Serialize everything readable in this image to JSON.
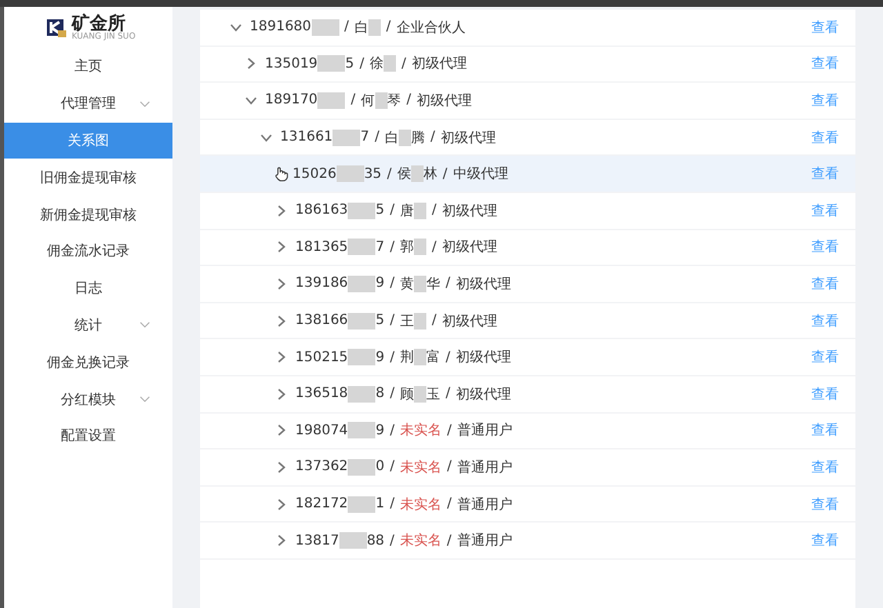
{
  "logo": {
    "name": "矿金所",
    "subtitle": "KUANG JIN SUO"
  },
  "sidebar": {
    "items": [
      {
        "label": "主页",
        "selected": false
      },
      {
        "label": "代理管理",
        "selected": false,
        "expandable": true
      },
      {
        "label": "关系图",
        "selected": true
      },
      {
        "label": "旧佣金提现审核",
        "selected": false
      },
      {
        "label": "新佣金提现审核",
        "selected": false
      },
      {
        "label": "佣金流水记录",
        "selected": false
      },
      {
        "label": "日志",
        "selected": false
      },
      {
        "label": "统计",
        "selected": false,
        "expandable": true
      },
      {
        "label": "佣金兑换记录",
        "selected": false
      },
      {
        "label": "分红模块",
        "selected": false,
        "expandable": true
      },
      {
        "label": "配置设置",
        "selected": false
      }
    ]
  },
  "separator": "/",
  "tree": [
    {
      "phone": {
        "start": "1891680"
      },
      "name": {
        "start": "白"
      },
      "masked": true,
      "unverified": false,
      "role": "企业合伙人",
      "action": "查看",
      "expanded": true,
      "selected": false,
      "children": [
        {
          "phone": {
            "start": "135019",
            "end": "5"
          },
          "name": {
            "start": "徐"
          },
          "masked": true,
          "unverified": false,
          "role": "初级代理",
          "action": "查看",
          "expanded": false,
          "selected": false
        },
        {
          "phone": {
            "start": "189170"
          },
          "name": {
            "start": "何",
            "end": "琴"
          },
          "masked": true,
          "unverified": false,
          "role": "初级代理",
          "action": "查看",
          "expanded": true,
          "selected": false,
          "children": [
            {
              "phone": {
                "start": "131661",
                "end": "7"
              },
              "name": {
                "start": "白",
                "end": "腾"
              },
              "masked": true,
              "unverified": false,
              "role": "初级代理",
              "action": "查看",
              "expanded": true,
              "selected": false,
              "children": [
                {
                  "phone": {
                    "start": "15026",
                    "end": "35"
                  },
                  "name": {
                    "start": "侯",
                    "end": "林"
                  },
                  "masked": true,
                  "unverified": false,
                  "role": "中级代理",
                  "action": "查看",
                  "expanded": false,
                  "selected": true
                },
                {
                  "phone": {
                    "start": "186163",
                    "end": "5"
                  },
                  "name": {
                    "start": "唐"
                  },
                  "masked": true,
                  "unverified": false,
                  "role": "初级代理",
                  "action": "查看",
                  "expanded": false,
                  "selected": false
                },
                {
                  "phone": {
                    "start": "181365",
                    "end": "7"
                  },
                  "name": {
                    "start": "郭"
                  },
                  "masked": true,
                  "unverified": false,
                  "role": "初级代理",
                  "action": "查看",
                  "expanded": false,
                  "selected": false
                },
                {
                  "phone": {
                    "start": "139186",
                    "end": "9"
                  },
                  "name": {
                    "start": "黄",
                    "end": "华"
                  },
                  "masked": true,
                  "unverified": false,
                  "role": "初级代理",
                  "action": "查看",
                  "expanded": false,
                  "selected": false
                },
                {
                  "phone": {
                    "start": "138166",
                    "end": "5"
                  },
                  "name": {
                    "start": "王"
                  },
                  "masked": true,
                  "unverified": false,
                  "role": "初级代理",
                  "action": "查看",
                  "expanded": false,
                  "selected": false
                },
                {
                  "phone": {
                    "start": "150215",
                    "end": "9"
                  },
                  "name": {
                    "start": "荆",
                    "end": "富"
                  },
                  "masked": true,
                  "unverified": false,
                  "role": "初级代理",
                  "action": "查看",
                  "expanded": false,
                  "selected": false
                },
                {
                  "phone": {
                    "start": "136518",
                    "end": "8"
                  },
                  "name": {
                    "start": "顾",
                    "end": "玉"
                  },
                  "masked": true,
                  "unverified": false,
                  "role": "初级代理",
                  "action": "查看",
                  "expanded": false,
                  "selected": false
                },
                {
                  "phone": {
                    "start": "198074",
                    "end": "9"
                  },
                  "name": {
                    "start": "未实名"
                  },
                  "masked": false,
                  "unverified": true,
                  "role": "普通用户",
                  "action": "查看",
                  "expanded": false,
                  "selected": false
                },
                {
                  "phone": {
                    "start": "137362",
                    "end": "0"
                  },
                  "name": {
                    "start": "未实名"
                  },
                  "masked": false,
                  "unverified": true,
                  "role": "普通用户",
                  "action": "查看",
                  "expanded": false,
                  "selected": false
                },
                {
                  "phone": {
                    "start": "182172",
                    "end": "1"
                  },
                  "name": {
                    "start": "未实名"
                  },
                  "masked": false,
                  "unverified": true,
                  "role": "普通用户",
                  "action": "查看",
                  "expanded": false,
                  "selected": false
                },
                {
                  "phone": {
                    "start": "13817",
                    "end": "88"
                  },
                  "name": {
                    "start": "未实名"
                  },
                  "masked": false,
                  "unverified": true,
                  "role": "普通用户",
                  "action": "查看",
                  "expanded": false,
                  "selected": false
                }
              ]
            }
          ]
        }
      ]
    }
  ]
}
